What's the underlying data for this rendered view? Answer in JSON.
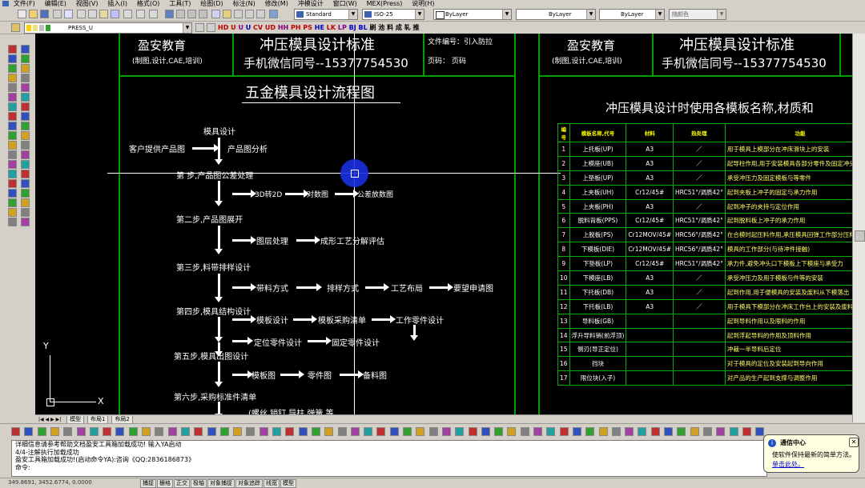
{
  "menu": [
    "文件(F)",
    "编辑(E)",
    "视图(V)",
    "插入(I)",
    "格式(O)",
    "工具(T)",
    "绘图(D)",
    "标注(N)",
    "修改(M)",
    "冲模设计",
    "窗口(W)",
    "MEX(Press)",
    "说明(H)"
  ],
  "toolbar": {
    "text_style": "Standard",
    "dim_style": "ISO-25",
    "color": "ByLayer",
    "linetype": "ByLayer",
    "lineweight": "ByLayer",
    "plot_style": "随颜色",
    "layer": "PRESS_U"
  },
  "press_tools": [
    "HD",
    "U",
    "U",
    "U",
    "CV",
    "UD",
    "HH",
    "PH",
    "PS",
    "HE",
    "LK",
    "LP",
    "BJ",
    "BL",
    "刷",
    "池",
    "料",
    "成",
    "轧",
    "推"
  ],
  "header_left": {
    "company": "盈安教育",
    "services": "(制图,设计,CAE,培训)",
    "standard_title": "冲压模具设计标准",
    "wechat": "手机微信同号--15377754530",
    "doc_no": "文件编号：引入防拉",
    "page": "页码：  页码"
  },
  "header_right": {
    "company": "盈安教育",
    "services": "(制图,设计,CAE,培训)",
    "standard_title": "冲压模具设计标准",
    "wechat": "手机微信同号--15377754530"
  },
  "flow": {
    "title": "五金模具设计流程图",
    "mold_design": "模具设计",
    "customer_drawing": "客户提供产品图",
    "drawing_analysis": "产品图分析",
    "step1": "第  步,产品图公差处理",
    "s1_a": "3D转2D",
    "s1_b": "对数图",
    "s1_c": "公差放数图",
    "step2": "第二步,产品图展开",
    "s2_a": "图层处理",
    "s2_b": "成形工艺分解评估",
    "step3": "第三步,料带排样设计",
    "s3_a": "带料方式",
    "s3_b": "排样方式",
    "s3_c": "工艺布局",
    "s3_d": "要望申请图",
    "step4": "第四步,模具结构设计",
    "s4_a": "模板设计",
    "s4_b": "模板采购清单",
    "s4_c": "工作零件设计",
    "s4_d": "定位零件设计",
    "s4_e": "固定零件设计",
    "step5": "第五步,模具出图设计",
    "s5_a": "模板图",
    "s5_b": "零件图",
    "s5_c": "备料图",
    "step6": "第六步,采购标准件清单",
    "s6_partial": "(螺丝  销钉  导柱  弹簧  等"
  },
  "table": {
    "title": "冲压模具设计时使用各模板名称,材质和",
    "headers": [
      "编号",
      "模板名称,代号",
      "材料",
      "热处理",
      "功能"
    ],
    "rows": [
      [
        "1",
        "上托板(UP)",
        "A3",
        "／",
        "用于模具上模部分在冲床滑块上的安装"
      ],
      [
        "2",
        "上模座(UB)",
        "A3",
        "／",
        "起导柱作用,用于安装模具各部分零件及固定冲头及高度"
      ],
      [
        "3",
        "上垫板(UP)",
        "A3",
        "／",
        "承受冲压力及固定模板与等零件"
      ],
      [
        "4",
        "上夹板(UH)",
        "Cr12/45#",
        "HRC51°/调质42°",
        "起到夹板上冲子的固定与承力作用"
      ],
      [
        "5",
        "上夹板(PH)",
        "A3",
        "／",
        "起到冲子的夹持与定位作用"
      ],
      [
        "6",
        "脱料背板(PPS)",
        "Cr12/45#",
        "HRC51°/调质42°",
        "起到脱料板上冲子的承力作用"
      ],
      [
        "7",
        "上脱板(PS)",
        "Cr12MOV/45#",
        "HRC56°/调质42°",
        "在合模时起压料作用,承压模具回弹工作部分压料力"
      ],
      [
        "8",
        "下模板(DIE)",
        "Cr12MOV/45#",
        "HRC56°/调质42°",
        "模具的工作部分(与待冲件接触)"
      ],
      [
        "9",
        "下垫板(LP)",
        "Cr12/45#",
        "HRC51°/调质42°",
        "承力件,避免冲头口下模板上下模座与承受力"
      ],
      [
        "10",
        "下模座(LB)",
        "A3",
        "／",
        "承受冲压力及用于模板与件等的安装"
      ],
      [
        "11",
        "下托板(DB)",
        "A3",
        "／",
        "起到作用,用于便模具的安装及废料从下模落出"
      ],
      [
        "12",
        "下托板(LB)",
        "A3",
        "／",
        "用于模具下模部分在冲床工作台上的安装及废料落出"
      ],
      [
        "13",
        "导料板(GB)",
        "",
        "",
        "起到导料作用以及限料的作用"
      ],
      [
        "14",
        "浮升导料销(前浮顶)",
        "",
        "",
        "起到浮起导料的作用及顶料作用"
      ],
      [
        "15",
        "侧刃(导正定位)",
        "",
        "",
        "冲裁一半导料后定位"
      ],
      [
        "16",
        "挡块",
        "",
        "",
        "对于模具的定位及安装起到导向作用"
      ],
      [
        "17",
        "限位块(入子)",
        "",
        "",
        "对产品的生产起到支撑与调整作用"
      ]
    ]
  },
  "axis": {
    "x": "X",
    "y": "Y"
  },
  "tabs": [
    "模型",
    "布局1",
    "布局2"
  ],
  "command_log": [
    "详细信息请参考帮助文档盈安工具箱加载成功! 输入YA启动",
    "4/4-注解执行加载成功",
    "盈安工具箱加载成功!(启动命令YA):咨询《QQ:2836186873》",
    "命令:"
  ],
  "status": {
    "coords": "349.8691, 3452.6774, 0.0000",
    "buttons": [
      "捕捉",
      "栅格",
      "正交",
      "极轴",
      "对象捕捉",
      "对象追踪",
      "线宽",
      "模型"
    ]
  },
  "notification": {
    "title": "通信中心",
    "message": "使软件保持最新的简单方法。",
    "link": "单击此处。"
  },
  "colors": {
    "canvas": "#000000",
    "frame": "#00a000",
    "table_line": "#00b000",
    "highlight": "#0000ff"
  }
}
